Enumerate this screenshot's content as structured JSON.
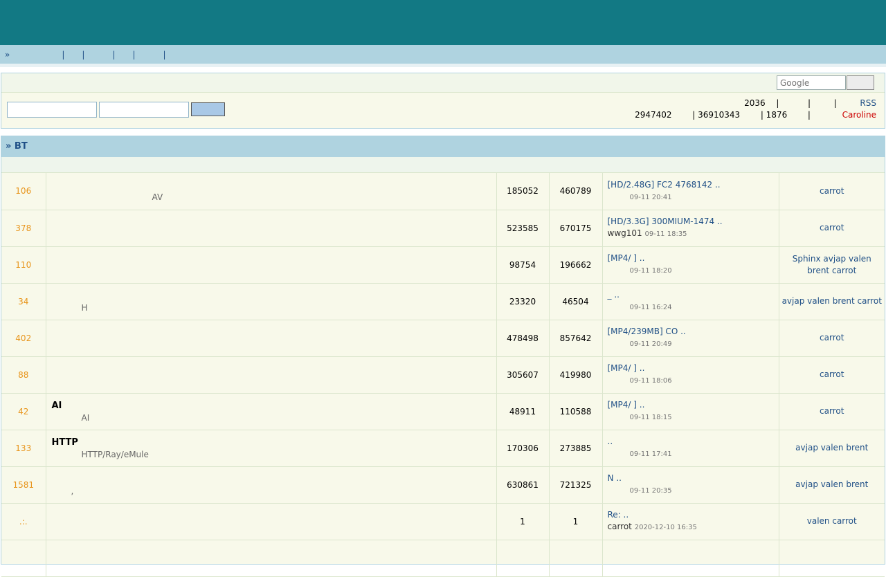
{
  "nav": {
    "prefix": "»",
    "items": [
      "",
      "",
      "",
      "",
      "",
      ""
    ],
    "separator": "|"
  },
  "search": {
    "placeholder": "Google"
  },
  "stats": {
    "line1": [
      "2036",
      "|",
      "",
      "|",
      "",
      "|",
      "RSS"
    ],
    "line2": [
      "2947402",
      "| 36910343",
      "| 1876",
      "|"
    ],
    "new_member": "Caroline"
  },
  "forum": {
    "title": "» BT",
    "rows": [
      {
        "today": "106",
        "name": "",
        "desc": "AV",
        "desc_indent": 145,
        "topics": "185052",
        "posts": "460789",
        "last_title": "[HD/2.48G] FC2 4768142   ..",
        "last_user": "",
        "last_time": "09-11 20:41",
        "mods": "carrot"
      },
      {
        "today": "378",
        "name": "",
        "desc": "",
        "topics": "523585",
        "posts": "670175",
        "last_title": "[HD/3.3G] 300MIUM-1474 ..",
        "last_user": "wwg101",
        "last_time": "09-11 18:35",
        "mods": "carrot"
      },
      {
        "today": "110",
        "name": "",
        "desc": "",
        "topics": "98754",
        "posts": "196662",
        "last_title": "[MP4/    ]          ..",
        "last_user": "",
        "last_time": "09-11 18:20",
        "mods": "Sphinx avjap valen brent carrot"
      },
      {
        "today": "34",
        "name": "",
        "desc": "H",
        "topics": "23320",
        "posts": "46504",
        "last_title": "               _ ..",
        "last_user": "",
        "last_time": "09-11 16:24",
        "mods": "avjap valen brent carrot"
      },
      {
        "today": "402",
        "name": "",
        "desc": "",
        "topics": "478498",
        "posts": "857642",
        "last_title": "[MP4/239MB]         CO ..",
        "last_user": "",
        "last_time": "09-11 20:49",
        "mods": "carrot"
      },
      {
        "today": "88",
        "name": "",
        "desc": "",
        "topics": "305607",
        "posts": "419980",
        "last_title": "[MP4/    ]          ..",
        "last_user": "",
        "last_time": "09-11 18:06",
        "mods": "carrot"
      },
      {
        "today": "42",
        "name": "AI",
        "desc": "AI",
        "topics": "48911",
        "posts": "110588",
        "last_title": "[MP4/    ]          ..",
        "last_user": "",
        "last_time": "09-11 18:15",
        "mods": "carrot"
      },
      {
        "today": "133",
        "name": "HTTP",
        "desc": "HTTP/Ray/eMule",
        "topics": "170306",
        "posts": "273885",
        "last_title": "                    ..",
        "last_user": "",
        "last_time": "09-11 17:41",
        "mods": "avjap valen brent"
      },
      {
        "today": "1581",
        "name": "",
        "desc": ",",
        "desc_indent": 28,
        "topics": "630861",
        "posts": "721325",
        "last_title": "                N ..",
        "last_user": "",
        "last_time": "09-11 20:35",
        "mods": "avjap valen brent"
      },
      {
        "today": ".:.",
        "name": "",
        "desc": "",
        "topics": "1",
        "posts": "1",
        "last_title": "Re:                 ..",
        "last_user": "carrot",
        "last_time": "2020-12-10 16:35",
        "mods": "valen carrot"
      },
      {
        "today": "",
        "name": "",
        "desc": "",
        "topics": "",
        "posts": "",
        "last_title": "",
        "last_user": "",
        "last_time": "",
        "mods": ""
      }
    ]
  }
}
